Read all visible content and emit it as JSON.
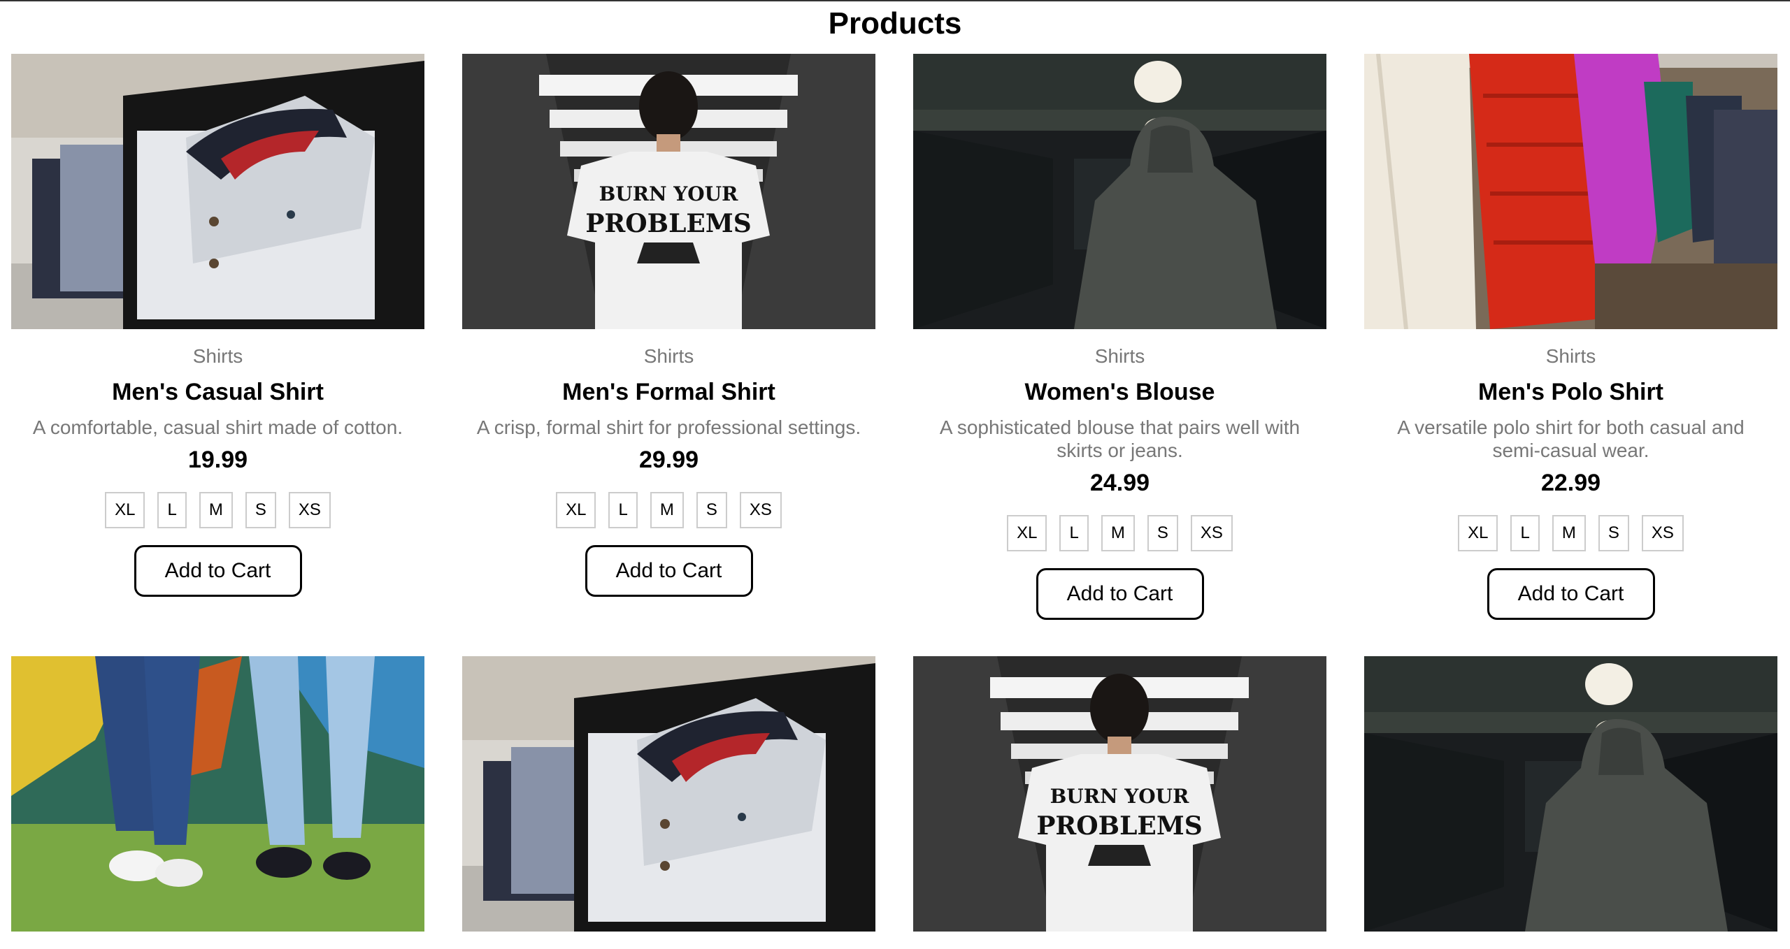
{
  "page": {
    "title": "Products"
  },
  "products": [
    {
      "category": "Shirts",
      "name": "Men's Casual Shirt",
      "description": "A comfortable, casual shirt made of cotton.",
      "price": "19.99",
      "sizes": [
        "XL",
        "L",
        "M",
        "S",
        "XS"
      ],
      "cart_label": "Add to Cart",
      "image": "folded-shirt-photo"
    },
    {
      "category": "Shirts",
      "name": "Men's Formal Shirt",
      "description": "A crisp, formal shirt for professional settings.",
      "price": "29.99",
      "sizes": [
        "XL",
        "L",
        "M",
        "S",
        "XS"
      ],
      "cart_label": "Add to Cart",
      "image": "tshirt-back-photo",
      "image_text": [
        "BURN YOUR",
        "PROBLEMS"
      ]
    },
    {
      "category": "Shirts",
      "name": "Women's Blouse",
      "description": "A sophisticated blouse that pairs well with skirts or jeans.",
      "price": "24.99",
      "sizes": [
        "XL",
        "L",
        "M",
        "S",
        "XS"
      ],
      "cart_label": "Add to Cart",
      "image": "hoodie-subway-photo"
    },
    {
      "category": "Shirts",
      "name": "Men's Polo Shirt",
      "description": "A versatile polo shirt for both casual and semi-casual wear.",
      "price": "22.99",
      "sizes": [
        "XL",
        "L",
        "M",
        "S",
        "XS"
      ],
      "cart_label": "Add to Cart",
      "image": "jackets-rack-photo"
    },
    {
      "image": "jeans-sneakers-photo"
    },
    {
      "image": "folded-shirt-photo"
    },
    {
      "image": "tshirt-back-photo",
      "image_text": [
        "BURN YOUR",
        "PROBLEMS"
      ]
    },
    {
      "image": "hoodie-subway-photo"
    }
  ],
  "colors": {
    "price_text": "#000000",
    "muted_text": "#777777",
    "button_border": "#000000",
    "size_border": "#cccccc"
  }
}
